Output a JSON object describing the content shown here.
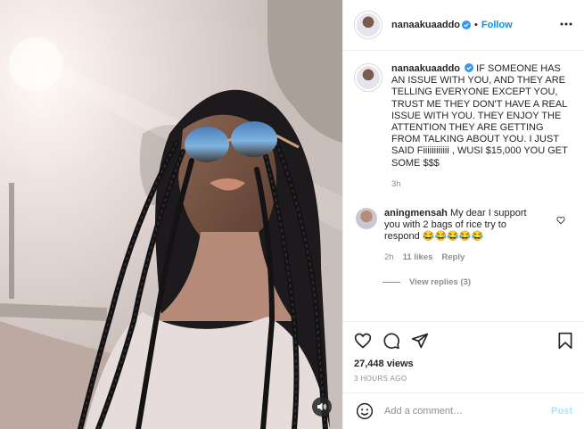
{
  "header": {
    "username": "nanaakuaaddo",
    "separator": "•",
    "follow_label": "Follow"
  },
  "caption": {
    "username": "nanaakuaaddo",
    "text": "IF SOMEONE HAS AN ISSUE WITH YOU, AND THEY ARE TELLING EVERYONE EXCEPT YOU, TRUST ME THEY DON'T HAVE A REAL ISSUE WITH YOU. THEY ENJOY THE ATTENTION THEY ARE GETTING FROM TALKING ABOUT YOU. I JUST SAID Fiiiiiiiiiiii , WUSI $15,000 YOU GET SOME $$$",
    "time": "3h"
  },
  "comment": {
    "username": "aningmensah",
    "text": "My dear I support you with 2 bags of rice try to respond 😂😂😂😂😂",
    "time": "2h",
    "likes": "11 likes",
    "reply_label": "Reply",
    "view_replies": "View replies (3)"
  },
  "stats": {
    "views": "27,448 views",
    "time_ago": "3 HOURS AGO"
  },
  "add_comment": {
    "placeholder": "Add a comment…",
    "post_label": "Post"
  },
  "colors": {
    "link_blue": "#0095f6",
    "post_disabled": "#b2dffc",
    "meta_grey": "#8e8e8e"
  },
  "icons": [
    "verified-badge-icon",
    "more-options-icon",
    "heart-icon",
    "comment-icon",
    "share-icon",
    "save-bookmark-icon",
    "emoji-icon",
    "sound-icon"
  ]
}
